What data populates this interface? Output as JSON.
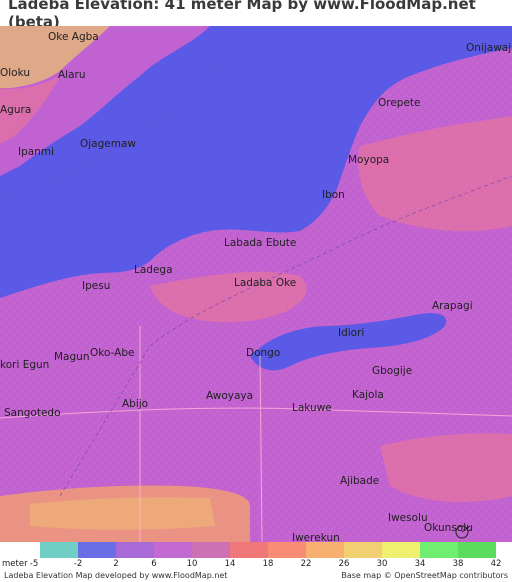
{
  "title": "Ladeba Elevation: 41 meter Map by www.FloodMap.net (beta)",
  "places": [
    {
      "name": "Oke Agba"
    },
    {
      "name": "Oloku"
    },
    {
      "name": "Alaru"
    },
    {
      "name": "Agura"
    },
    {
      "name": "Ojagemaw"
    },
    {
      "name": "Ipanmi"
    },
    {
      "name": "Onijawaja"
    },
    {
      "name": "Orepete"
    },
    {
      "name": "Moyopa"
    },
    {
      "name": "Ibon"
    },
    {
      "name": "Labada Ebute"
    },
    {
      "name": "Ladega"
    },
    {
      "name": "Ladaba Oke"
    },
    {
      "name": "Ipesu"
    },
    {
      "name": "Arapagi"
    },
    {
      "name": "Idiori"
    },
    {
      "name": "Magun"
    },
    {
      "name": "Oko-Abe"
    },
    {
      "name": "kori Egun"
    },
    {
      "name": "Dongo"
    },
    {
      "name": "Gbogije"
    },
    {
      "name": "Kajola"
    },
    {
      "name": "Sangotedo"
    },
    {
      "name": "Abijo"
    },
    {
      "name": "Awoyaya"
    },
    {
      "name": "Lakuwe"
    },
    {
      "name": "Ajibade"
    },
    {
      "name": "Iwesolu"
    },
    {
      "name": "Okunsolu"
    },
    {
      "name": "Iwerekun"
    }
  ],
  "legend": {
    "unit_label": "meter",
    "ticks": [
      "-5",
      "-2",
      "2",
      "6",
      "10",
      "14",
      "18",
      "22",
      "26",
      "30",
      "34",
      "38",
      "42"
    ],
    "colors": [
      "#6fcfc4",
      "#6a6ee6",
      "#a86ad6",
      "#c26ad2",
      "#cc72b4",
      "#f07878",
      "#f88c74",
      "#f8b070",
      "#f0d070",
      "#f0f070",
      "#70ee70",
      "#5cdc5c"
    ]
  },
  "footer": {
    "left": "Ladeba Elevation Map developed by www.FloodMap.net",
    "right": "Base map © OpenStreetMap contributors"
  },
  "colors": {
    "water": "#5a5ae6",
    "land": "#c062d2",
    "highland": "#f07a90"
  }
}
